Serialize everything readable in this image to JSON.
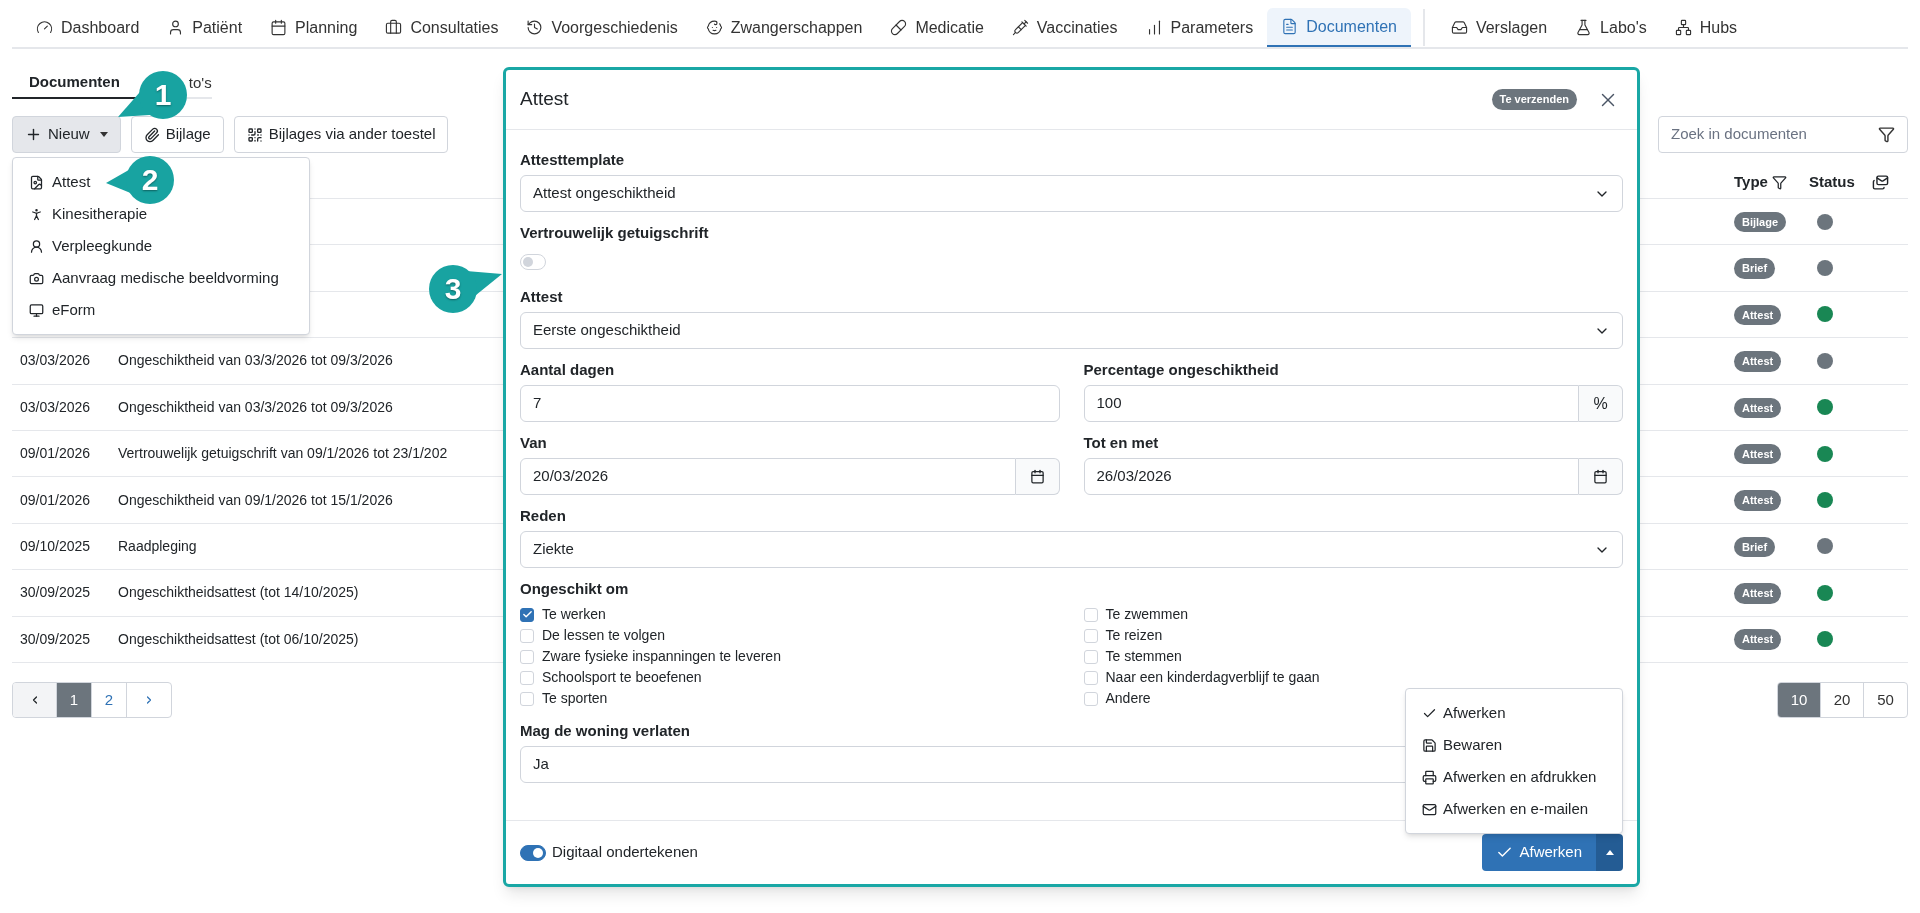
{
  "nav_groups": [
    [
      {
        "label": "Dashboard",
        "selected": false
      },
      {
        "label": "Patiënt",
        "selected": false
      },
      {
        "label": "Planning",
        "selected": false
      },
      {
        "label": "Consultaties",
        "selected": false
      },
      {
        "label": "Voorgeschiedenis",
        "selected": false
      },
      {
        "label": "Zwangerschappen",
        "selected": false
      },
      {
        "label": "Medicatie",
        "selected": false
      },
      {
        "label": "Vaccinaties",
        "selected": false
      },
      {
        "label": "Parameters",
        "selected": false
      },
      {
        "label": "Documenten",
        "selected": true
      }
    ],
    [
      {
        "label": "Verslagen",
        "selected": false
      },
      {
        "label": "Labo's",
        "selected": false
      },
      {
        "label": "Hubs",
        "selected": false
      }
    ]
  ],
  "subtabs": [
    {
      "label": "Documenten",
      "selected": true
    },
    {
      "label": "to's",
      "selected": false
    }
  ],
  "toolbar": {
    "new_button": "Nieuw",
    "buttons": [
      "Bijlage",
      "Bijlages via ander toestel"
    ],
    "search": {
      "placeholder": "Zoek in documenten"
    }
  },
  "new_menu": [
    "Attest",
    "Kinesitherapie",
    "Verpleegkunde",
    "Aanvraag medische beeldvorming",
    "eForm"
  ],
  "table": {
    "columns": [
      "Type",
      "Status"
    ],
    "rows": [
      {
        "type": "Bijlage",
        "color": "#6c757d"
      },
      {
        "type": "Brief",
        "color": "#6c757d"
      },
      {
        "type": "Attest",
        "color": "#198754"
      },
      {
        "date": "03/03/2026",
        "description": "Ongeschiktheid van 03/3/2026 tot 09/3/2026",
        "type": "Attest",
        "color": "#6c757d"
      },
      {
        "date": "03/03/2026",
        "description": "Ongeschiktheid van 03/3/2026 tot 09/3/2026",
        "type": "Attest",
        "color": "#198754"
      },
      {
        "date": "09/01/2026",
        "description": "Vertrouwelijk getuigschrift van 09/1/2026 tot 23/1/202",
        "type": "Attest",
        "color": "#198754"
      },
      {
        "date": "09/01/2026",
        "description": "Ongeschiktheid van 09/1/2026 tot 15/1/2026",
        "type": "Attest",
        "color": "#198754"
      },
      {
        "date": "09/10/2025",
        "description": "Raadpleging",
        "type": "Brief",
        "color": "#6c757d"
      },
      {
        "date": "30/09/2025",
        "description": "Ongeschiktheidsattest (tot 14/10/2025)",
        "type": "Attest",
        "color": "#198754"
      },
      {
        "date": "30/09/2025",
        "description": "Ongeschiktheidsattest (tot 06/10/2025)",
        "type": "Attest",
        "color": "#198754"
      }
    ]
  },
  "pagination": {
    "pages": [
      {
        "label": "1",
        "selected": true
      },
      {
        "label": "2",
        "selected": false
      }
    ]
  },
  "page_sizes": [
    {
      "label": "10",
      "selected": true
    },
    {
      "label": "20",
      "selected": false
    },
    {
      "label": "50",
      "selected": false
    }
  ],
  "modal": {
    "title": "Attest",
    "badge": "Te verzenden",
    "template": {
      "label": "Attesttemplate",
      "value": "Attest ongeschiktheid"
    },
    "confidential": {
      "label": "Vertrouwelijk getuigschrift",
      "on": false
    },
    "attest": {
      "label": "Attest",
      "value": "Eerste ongeschiktheid"
    },
    "days": {
      "label": "Aantal dagen",
      "value": "7"
    },
    "percentage": {
      "label": "Percentage ongeschiktheid",
      "value": "100",
      "unit": "%"
    },
    "from": {
      "label": "Van",
      "value": "20/03/2026"
    },
    "until": {
      "label": "Tot en met",
      "value": "26/03/2026"
    },
    "reason": {
      "label": "Reden",
      "value": "Ziekte"
    },
    "unfit_for": {
      "label": "Ongeschikt om",
      "options": [
        {
          "label": "Te werken",
          "checked": true
        },
        {
          "label": "Te zwemmen",
          "checked": false
        },
        {
          "label": "De lessen te volgen",
          "checked": false
        },
        {
          "label": "Te reizen",
          "checked": false
        },
        {
          "label": "Zware fysieke inspanningen te leveren",
          "checked": false
        },
        {
          "label": "Te stemmen",
          "checked": false
        },
        {
          "label": "Schoolsport te beoefenen",
          "checked": false
        },
        {
          "label": "Naar een kinderdagverblijf te gaan",
          "checked": false
        },
        {
          "label": "Te sporten",
          "checked": false
        },
        {
          "label": "Andere",
          "checked": false
        }
      ]
    },
    "may_leave_home": {
      "label": "Mag de woning verlaten",
      "value": "Ja"
    },
    "digital_sign": {
      "label": "Digitaal ondertekenen",
      "on": true
    },
    "submit": "Afwerken",
    "actions_menu": [
      "Afwerken",
      "Bewaren",
      "Afwerken en afdrukken",
      "Afwerken en e-mailen"
    ]
  },
  "callouts": [
    "1",
    "2",
    "3"
  ]
}
